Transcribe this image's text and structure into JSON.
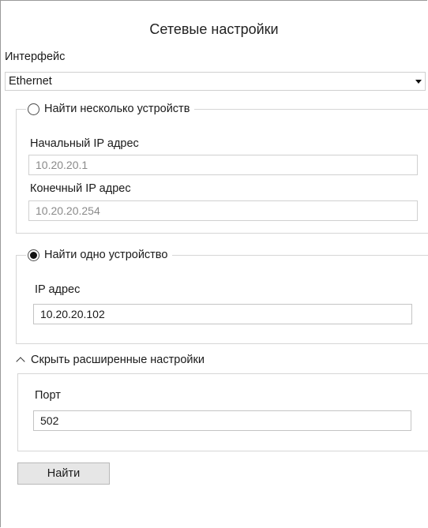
{
  "title": "Сетевые настройки",
  "interface": {
    "label": "Интерфейс",
    "selected": "Ethernet"
  },
  "multi_search": {
    "label": "Найти несколько устройств",
    "selected": false,
    "start_ip_label": "Начальный IP адрес",
    "start_ip_value": "10.20.20.1",
    "end_ip_label": "Конечный IP адрес",
    "end_ip_value": "10.20.20.254"
  },
  "single_search": {
    "label": "Найти одно устройство",
    "selected": true,
    "ip_label": "IP адрес",
    "ip_value": "10.20.20.102"
  },
  "advanced": {
    "toggle_label": "Скрыть расширенные настройки",
    "port_label": "Порт",
    "port_value": "502"
  },
  "find_button": "Найти"
}
